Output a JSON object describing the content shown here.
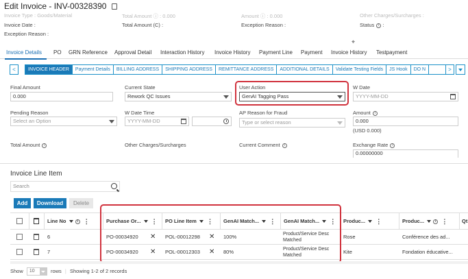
{
  "page": {
    "title": "Edit Invoice - INV-00328390"
  },
  "meta": {
    "invoice_type": "Invoice Type : Goods/Material",
    "total_amount_top": "Total Amount ⓘ : 0.000",
    "amount_top": "Amount ⓘ : 0.000",
    "other_charges_top": "Other Charges/Surcharges :",
    "invoice_date": "Invoice Date :",
    "total_amount_c_label": "Total Amount (C) :",
    "exception_reason_mid": "Exception Reason :",
    "status_label": "Status",
    "exception_reason_left": "Exception Reason :"
  },
  "tabs": [
    "Invoice Details",
    "PO",
    "GRN Reference",
    "Approval Detail",
    "Interaction History",
    "Invoice History",
    "Payment Line",
    "Payment",
    "Invoice History",
    "Testpayment"
  ],
  "subtabs": [
    "INVOICE HEADER",
    "Payment Details",
    "BILLING ADDRESS",
    "SHIPPING ADDRESS",
    "REMITTANCE ADDRESS",
    "ADDITIONAL DETAILS",
    "Validate Testing Fields",
    "JS Hook",
    "DO N"
  ],
  "nav": {
    "prev": "<",
    "next": ">",
    "more": "⌄"
  },
  "form": {
    "final_amount_label": "Final Amount",
    "final_amount_value": "0.000",
    "current_state_label": "Current State",
    "current_state_value": "Rework QC Issues",
    "user_action_label": "User Action",
    "user_action_value": "GenAI Tagging Pass",
    "w_date_label": "W Date",
    "w_date_placeholder": "YYYY-MM-DD",
    "pending_reason_label": "Pending Reason",
    "pending_reason_placeholder": "Select an Option",
    "w_date_time_label": "W Date Time",
    "w_date_time_placeholder": "YYYY-MM-DD",
    "ap_reason_label": "AP Reason for Fraud",
    "ap_reason_placeholder": "Type or select reason",
    "amount_label": "Amount",
    "amount_value": "0.000",
    "amount_usd": "(USD 0.000)",
    "total_amount_label": "Total Amount",
    "other_charges_label": "Other Charges/Surcharges",
    "current_comment_label": "Current Comment",
    "exchange_rate_label": "Exchange Rate",
    "exchange_rate_value": "0.00000000"
  },
  "line_items": {
    "title": "Invoice Line Item",
    "search_placeholder": "Search",
    "add_label": "Add",
    "download_label": "Download",
    "delete_label": "Delete",
    "columns": [
      "Line No",
      "Purchase Or...",
      "PO Line Item",
      "GenAI Match...",
      "GenAI Match...",
      "Produc...",
      "Produc...",
      "Qt"
    ],
    "rows": [
      {
        "line_no": "6",
        "po": "PO-00034920",
        "po_line": "POL-00012298",
        "match1": "100%",
        "match2_a": "Product/Service Desc",
        "match2_b": "Matched",
        "prod1": "Rose",
        "prod2": "Conférence des ad..."
      },
      {
        "line_no": "7",
        "po": "PO-00034920",
        "po_line": "POL-00012303",
        "match1": "80%",
        "match2_a": "Product/Service Desc",
        "match2_b": "Matched",
        "prod1": "Kite",
        "prod2": "Fondation éducative..."
      }
    ],
    "footer_show": "Show",
    "footer_rows_value": "10",
    "footer_rows": "rows",
    "footer_showing": "Showing 1-2 of 2 records"
  },
  "colors": {
    "accent": "#1a7ab8",
    "highlight": "#d0313c"
  }
}
